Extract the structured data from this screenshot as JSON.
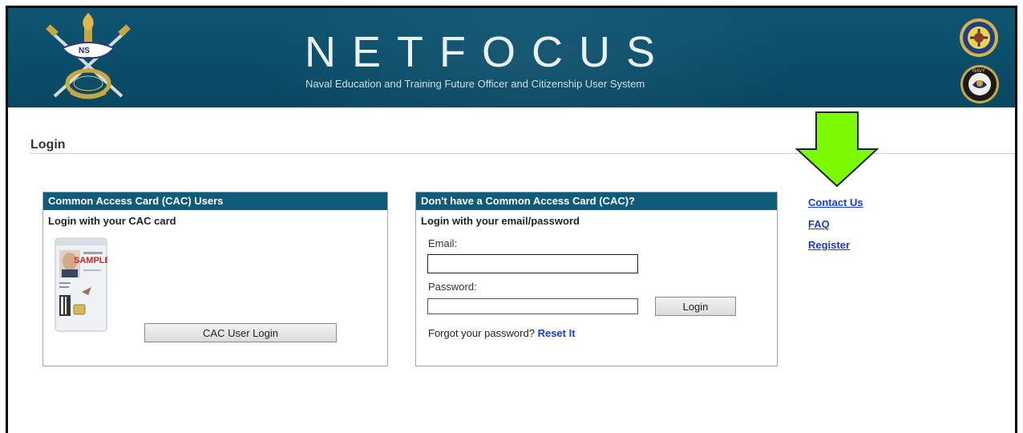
{
  "banner": {
    "title": "NETFOCUS",
    "subtitle": "Naval Education and Training Future Officer and Citizenship User System",
    "background_color": "#0a4d69",
    "left_emblem_icon": "nrotc-crest-emblem-icon",
    "top_seal_icon": "seal-icon",
    "bottom_seal_icon": "navy-seal-icon"
  },
  "page": {
    "title": "Login"
  },
  "arrow": {
    "icon": "green-down-arrow-icon",
    "color": "#7cfc00"
  },
  "cac_panel": {
    "header": "Common Access Card (CAC) Users",
    "subheading": "Login with your CAC card",
    "card_image_icon": "cac-card-sample-icon",
    "card_sample_text": "SAMPLE",
    "login_button": "CAC User Login"
  },
  "password_panel": {
    "header": "Don't have a Common Access Card (CAC)?",
    "subheading": "Login with your email/password",
    "email_label": "Email:",
    "email_value": "",
    "password_label": "Password:",
    "password_value": "",
    "login_button": "Login",
    "forgot_text": "Forgot your password?",
    "reset_link": "Reset It"
  },
  "side_links": {
    "contact": "Contact Us",
    "faq": "FAQ",
    "register": "Register"
  },
  "colors": {
    "panel_header": "#0f5b7a",
    "link": "#1a3ccf"
  }
}
